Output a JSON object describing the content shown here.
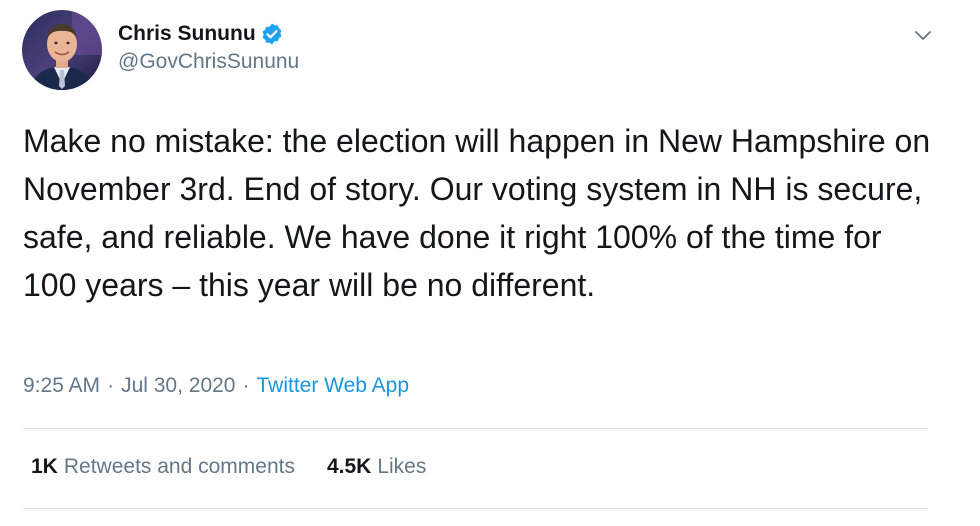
{
  "author": {
    "display_name": "Chris Sununu",
    "handle": "@GovChrisSununu",
    "verified": true,
    "avatar_icon": "profile-photo"
  },
  "tweet": {
    "text": "Make no mistake: the election will happen in New Hampshire on November 3rd.  End of story. Our voting system in NH is secure, safe, and reliable. We have done it right 100% of the time for 100 years – this year will be no different.",
    "time": "9:25 AM",
    "separator": "·",
    "date": "Jul 30, 2020",
    "source": "Twitter Web App"
  },
  "stats": {
    "retweets_count": "1K",
    "retweets_label": "Retweets and comments",
    "likes_count": "4.5K",
    "likes_label": "Likes"
  },
  "colors": {
    "text": "#14171a",
    "secondary": "#657786",
    "link": "#1b95e0",
    "verified": "#1da1f2",
    "divider": "#e1e8ed"
  },
  "icons": {
    "verified": "verified-badge-icon",
    "menu": "chevron-down-icon"
  }
}
